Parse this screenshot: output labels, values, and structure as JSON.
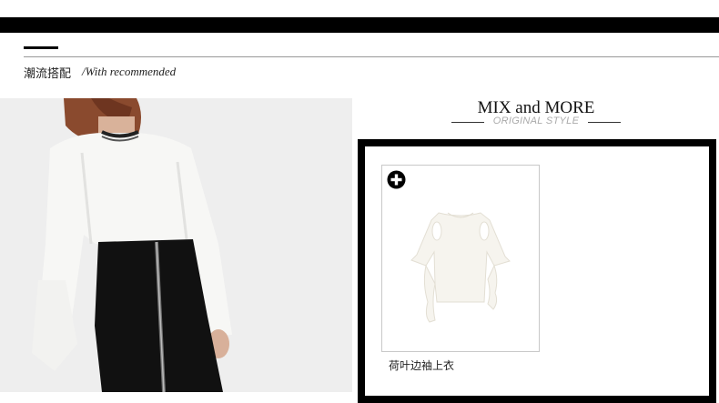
{
  "header": {
    "section_title": "潮流搭配",
    "section_subtitle": "/With recommended"
  },
  "promo": {
    "title": "MIX and MORE",
    "subtitle": "ORIGINAL STYLE"
  },
  "product": {
    "name": "荷叶边袖上衣",
    "icon": "plus-circle-icon"
  },
  "colors": {
    "bar": "#000000",
    "subtitle_gray": "#aaaaaa",
    "card_border": "#c8c8c8"
  }
}
